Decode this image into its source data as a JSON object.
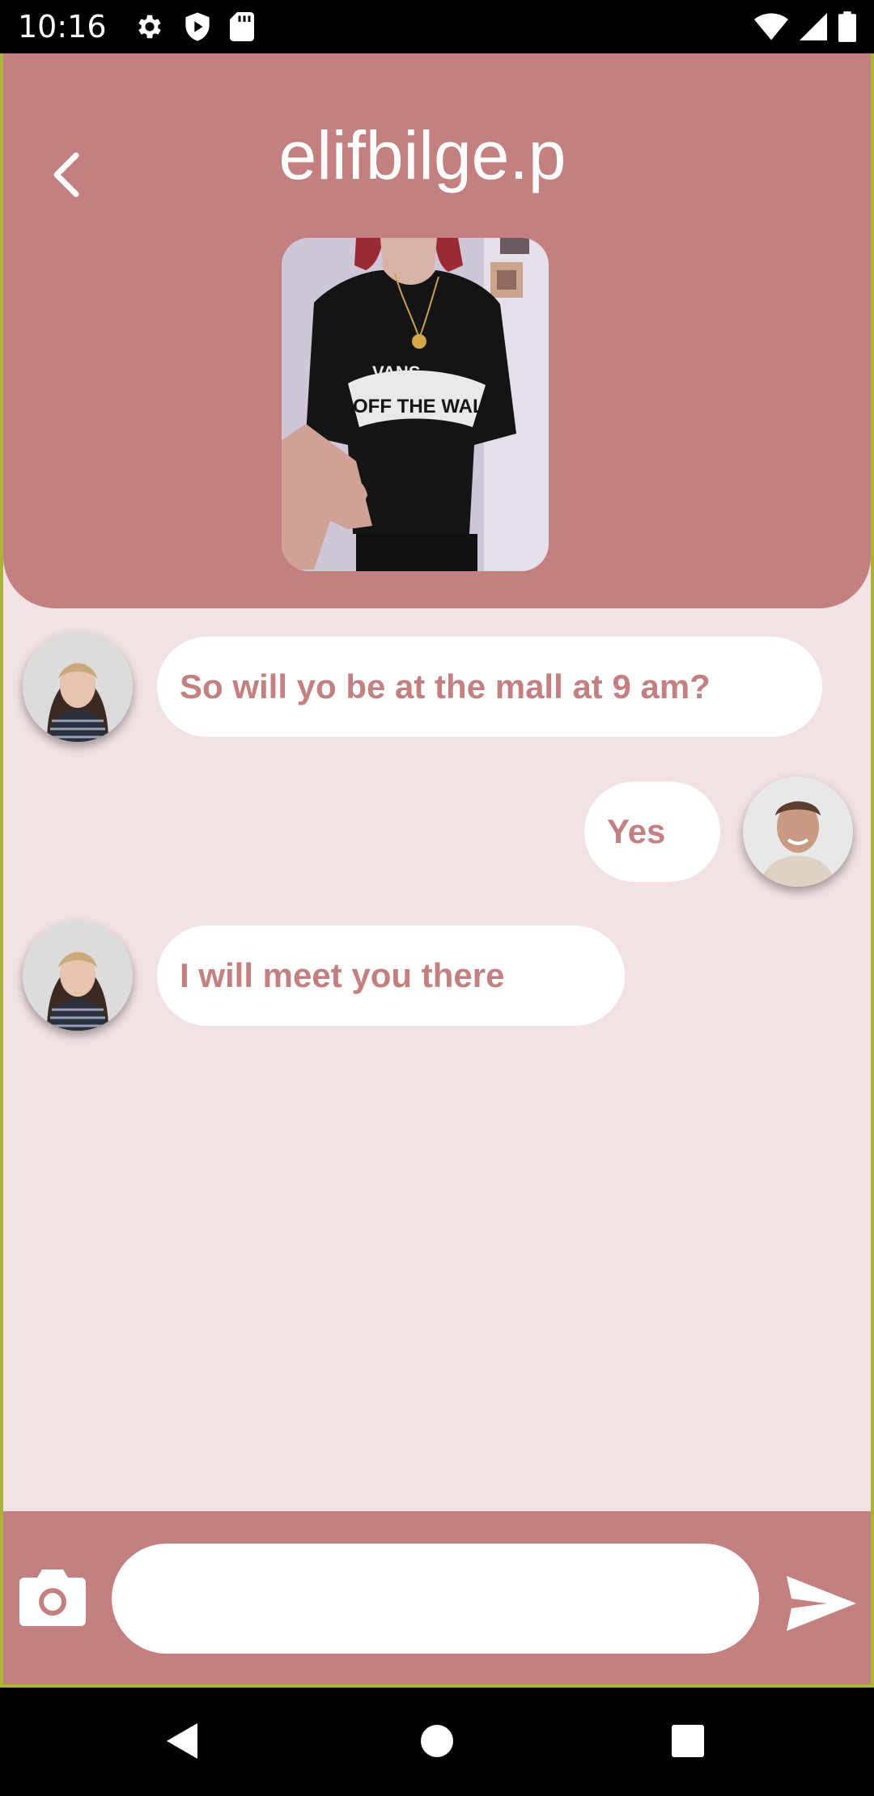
{
  "status_bar": {
    "time": "10:16",
    "icons_left": [
      "settings-icon",
      "shield-play-icon",
      "sd-card-icon"
    ],
    "icons_right": [
      "wifi-icon",
      "signal-icon",
      "battery-icon"
    ]
  },
  "header": {
    "title": "elifbilge.p",
    "back_icon": "chevron-left-icon",
    "background_color": "#C47F80"
  },
  "messages": [
    {
      "sender": "other",
      "text": "So will yo be at the mall at 9 am?"
    },
    {
      "sender": "me",
      "text": "Yes"
    },
    {
      "sender": "other",
      "text": "I will meet you there"
    }
  ],
  "input_bar": {
    "placeholder": "",
    "camera_icon": "camera-icon",
    "send_icon": "send-icon"
  },
  "nav_bar": {
    "icons": [
      "back-triangle-icon",
      "home-circle-icon",
      "recents-square-icon"
    ]
  },
  "colors": {
    "accent": "#C47F80",
    "chat_background": "#F3E2E4",
    "bubble": "#FFFFFF"
  }
}
